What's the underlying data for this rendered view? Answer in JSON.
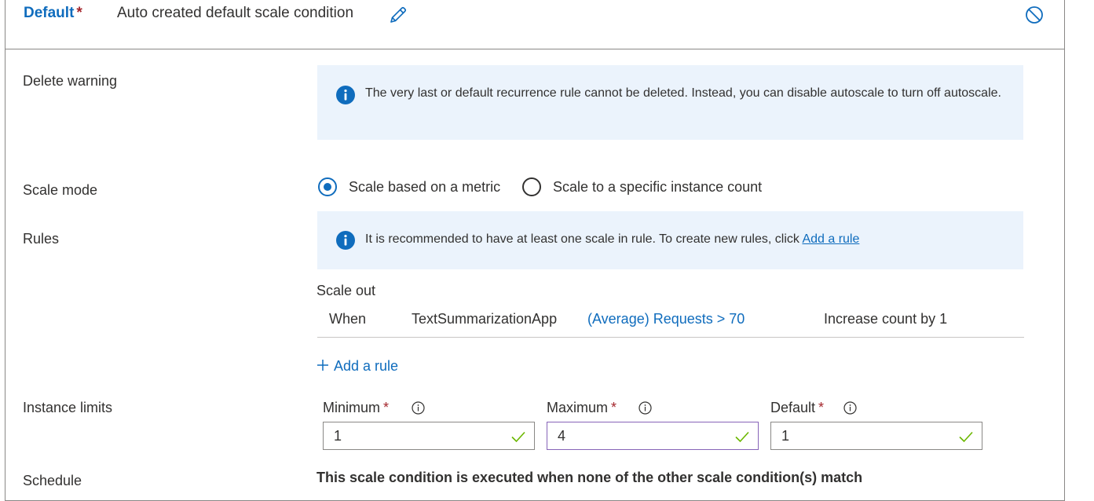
{
  "header": {
    "title": "Default",
    "required_marker": "*",
    "description": "Auto created default scale condition"
  },
  "delete_warning": {
    "label": "Delete warning",
    "message": "The very last or default recurrence rule cannot be deleted. Instead, you can disable autoscale to turn off autoscale."
  },
  "scale_mode": {
    "label": "Scale mode",
    "options": [
      {
        "label": "Scale based on a metric",
        "selected": true
      },
      {
        "label": "Scale to a specific instance count",
        "selected": false
      }
    ]
  },
  "rules": {
    "label": "Rules",
    "info_text": "It is recommended to have at least one scale in rule. To create new rules, click",
    "info_link": "Add a rule",
    "scale_out": {
      "heading": "Scale out",
      "when": "When",
      "resource": "TextSummarizationApp",
      "condition": "(Average) Requests > 70",
      "action": "Increase count by 1"
    },
    "add_rule": "Add a rule"
  },
  "instance_limits": {
    "label": "Instance limits",
    "minimum": {
      "label": "Minimum",
      "value": "1"
    },
    "maximum": {
      "label": "Maximum",
      "value": "4"
    },
    "default": {
      "label": "Default",
      "value": "1"
    }
  },
  "schedule": {
    "label": "Schedule",
    "text": "This scale condition is executed when none of the other scale condition(s) match"
  },
  "colors": {
    "accent": "#0f6cbd",
    "required": "#a4262c",
    "success": "#6bb700",
    "info_bg": "#ebf3fc",
    "focus_border": "#8764b8"
  }
}
